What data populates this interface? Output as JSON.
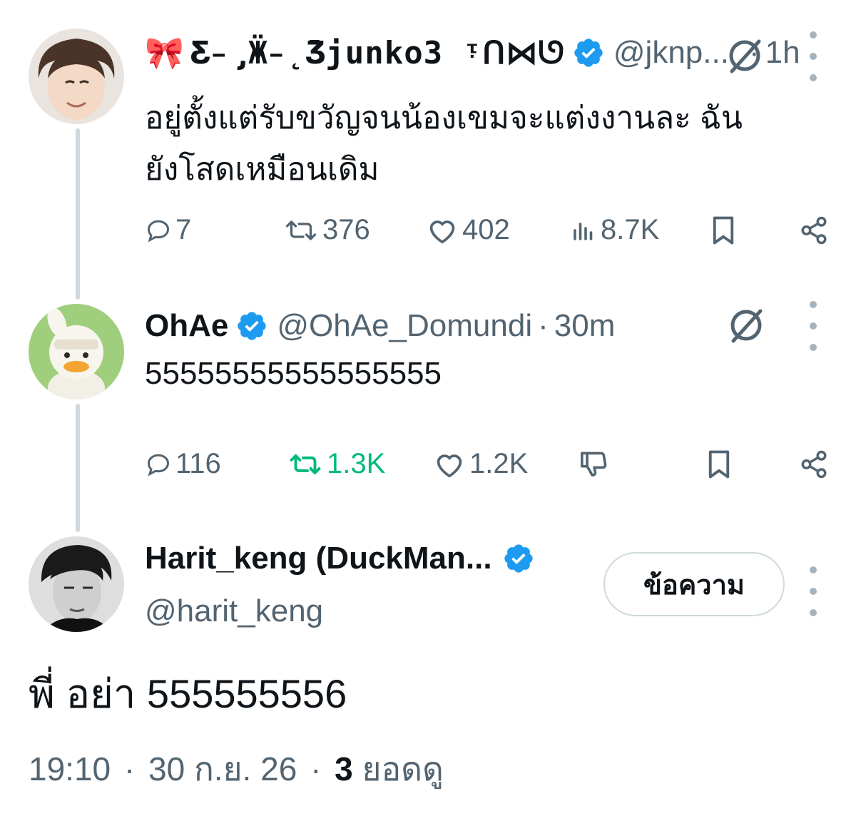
{
  "tweet1": {
    "emoji": "🎀",
    "name": "Ƹ̵̡Ӝ̵̨̄Ʒjunko3 ᵎᑎ⋈ᘎ",
    "handle": "@jknp...",
    "time": "1h",
    "text_line1": "อยู่ตั้งแต่รับขวัญจนน้องเขมจะแต่งงานละ ฉัน",
    "text_line2": "ยังโสดเหมือนเดิม",
    "replies": "7",
    "reposts": "376",
    "likes": "402",
    "views": "8.7K"
  },
  "tweet2": {
    "name": "OhAe",
    "handle": "@OhAe_Domundi",
    "time": "30m",
    "text": "55555555555555555",
    "replies": "116",
    "reposts": "1.3K",
    "likes": "1.2K"
  },
  "main": {
    "name": "Harit_keng (DuckMan...",
    "handle": "@harit_keng",
    "message_button": "ข้อความ",
    "text": "พี่ อย่า 555555556",
    "time": "19:10",
    "date": "30 ก.ย. 26",
    "views_count": "3",
    "views_label": "ยอดดู"
  },
  "separator": "·",
  "colors": {
    "verified": "#1d9bf0",
    "repost_active": "#00ba7c",
    "muted": "#536471",
    "thread_line": "#cfd9de"
  },
  "icons": [
    "ribbon-emoji",
    "verified-icon",
    "grok-icon",
    "more-icon",
    "reply-icon",
    "repost-icon",
    "like-icon",
    "views-icon",
    "bookmark-icon",
    "share-icon",
    "downvote-icon"
  ]
}
